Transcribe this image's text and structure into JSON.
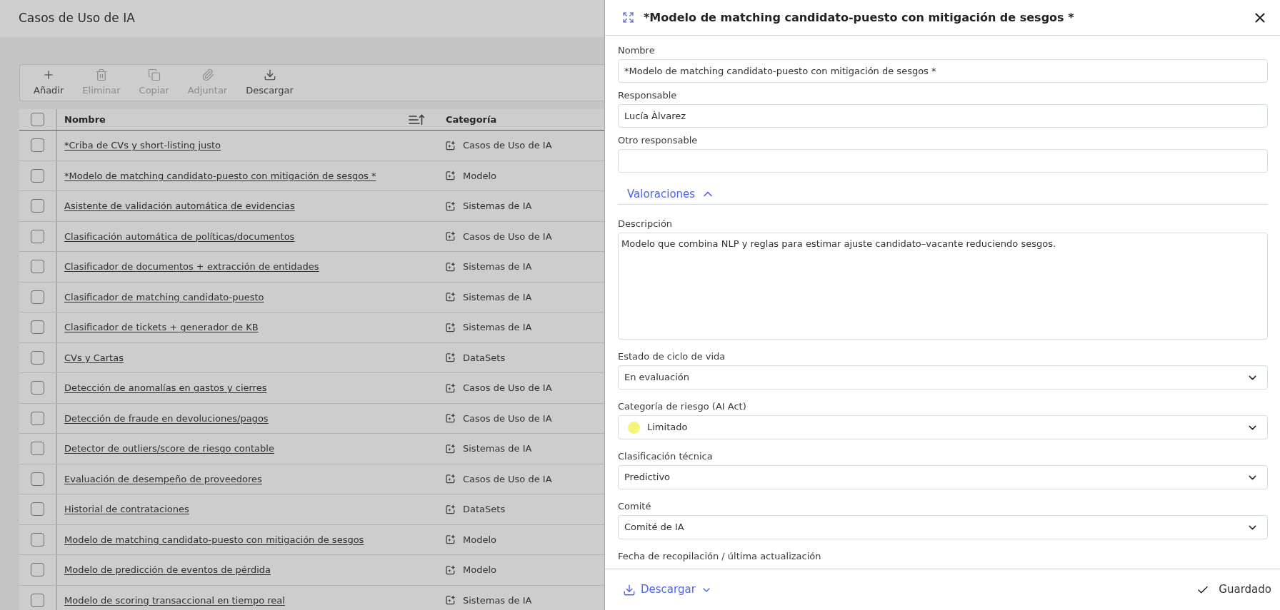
{
  "page": {
    "title": "Casos de Uso de IA"
  },
  "toolbar": [
    {
      "kind": "add",
      "label": "Añadir",
      "disabled": false
    },
    {
      "kind": "delete",
      "label": "Eliminar",
      "disabled": true
    },
    {
      "kind": "copy",
      "label": "Copiar",
      "disabled": true
    },
    {
      "kind": "attach",
      "label": "Adjuntar",
      "disabled": true
    },
    {
      "kind": "download",
      "label": "Descargar",
      "disabled": false
    }
  ],
  "table": {
    "select_all": {
      "checked": false
    },
    "columns": [
      {
        "label": "Nombre",
        "sorted": true
      },
      {
        "label": "Categoría",
        "sorted": false
      }
    ],
    "rows": [
      {
        "checked": false,
        "name": "*Criba de CVs y short-listing justo",
        "category": "Casos de Uso de IA"
      },
      {
        "checked": false,
        "name": "*Modelo de matching candidato-puesto con mitigación de sesgos *",
        "category": "Modelo"
      },
      {
        "checked": false,
        "name": "Asistente de validación automática de evidencias",
        "category": "Sistemas de IA"
      },
      {
        "checked": false,
        "name": "Clasificación automática de políticas/documentos",
        "category": "Casos de Uso de IA"
      },
      {
        "checked": false,
        "name": "Clasificador de documentos + extracción de entidades",
        "category": "Sistemas de IA"
      },
      {
        "checked": false,
        "name": "Clasificador de matching candidato-puesto",
        "category": "Sistemas de IA"
      },
      {
        "checked": false,
        "name": "Clasificador de tickets + generador de KB",
        "category": "Sistemas de IA"
      },
      {
        "checked": false,
        "name": "CVs y Cartas",
        "category": "DataSets"
      },
      {
        "checked": false,
        "name": "Detección de anomalías en gastos y cierres",
        "category": "Casos de Uso de IA"
      },
      {
        "checked": false,
        "name": "Detección de fraude en devoluciones/pagos",
        "category": "Casos de Uso de IA"
      },
      {
        "checked": false,
        "name": "Detector de outliers/score de riesgo contable",
        "category": "Sistemas de IA"
      },
      {
        "checked": false,
        "name": "Evaluación de desempeño de proveedores",
        "category": "Casos de Uso de IA"
      },
      {
        "checked": false,
        "name": "Historial de contrataciones",
        "category": "DataSets"
      },
      {
        "checked": false,
        "name": "Modelo de matching candidato-puesto con mitigación de sesgos",
        "category": "Modelo"
      },
      {
        "checked": false,
        "name": "Modelo de predicción de eventos de pérdida",
        "category": "Modelo"
      },
      {
        "checked": false,
        "name": "Modelo de scoring transaccional en tiempo real",
        "category": "Sistemas de IA"
      }
    ]
  },
  "panel": {
    "title": "*Modelo de matching candidato-puesto con mitigación de sesgos *",
    "fields": [
      {
        "kind": "text",
        "label": "Nombre",
        "value": "*Modelo de matching candidato-puesto con mitigación de sesgos *"
      },
      {
        "kind": "text",
        "label": "Responsable",
        "value": "Lucía Àlvarez"
      },
      {
        "kind": "text",
        "label": "Otro responsable"
      },
      {
        "kind": "section",
        "label": "Valoraciones",
        "expanded": true
      },
      {
        "kind": "textarea",
        "label": "Descripción",
        "value": "Modelo que combina NLP y reglas para estimar ajuste candidato–vacante reduciendo sesgos."
      },
      {
        "kind": "select",
        "label": "Estado de ciclo de vida",
        "value": "En evaluación"
      },
      {
        "kind": "select",
        "label": "Categoría de riesgo (AI Act)",
        "value": "Limitado",
        "color": "#f5f57a"
      },
      {
        "kind": "select",
        "label": "Clasificación técnica",
        "value": "Predictivo"
      },
      {
        "kind": "select",
        "label": "Comité",
        "value": "Comité de IA"
      },
      {
        "kind": "label",
        "label": "Fecha de recopilación / última actualización"
      }
    ],
    "footer": {
      "download": "Descargar",
      "status": "Guardado"
    }
  }
}
